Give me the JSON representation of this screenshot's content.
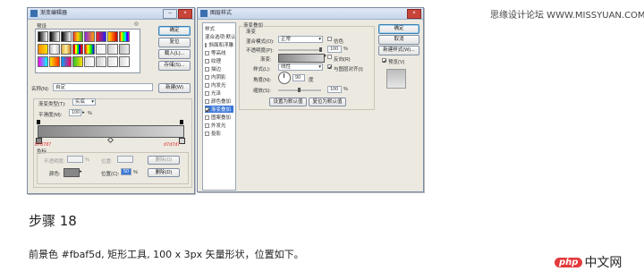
{
  "watermark": "思缘设计论坛 WWW.MISSYUAN.COM",
  "gradient_editor": {
    "title": "渐变编辑器",
    "presets_label": "预设",
    "ok": "确定",
    "reset": "复位",
    "load": "载入(L)...",
    "save": "存储(S)...",
    "name_label": "名称(N):",
    "name_value": "自定",
    "new": "新建(W)",
    "type_label": "渐变类型(T):",
    "type_value": "实底",
    "smooth_label": "平滑度(M):",
    "smooth_value": "100",
    "smooth_unit": "%",
    "stop_left_value": "878787",
    "stop_right_value": "d7d7d7",
    "stops_label": "色标",
    "opacity_label": "不透明度:",
    "opacity_unit": "%",
    "location_label": "位置:",
    "delete": "删除(D)",
    "color_label": "颜色:",
    "location2_label": "位置(C):",
    "location2_value": "50",
    "delete2": "删除(D)"
  },
  "layer_style": {
    "title": "图层样式",
    "styles_label": "样式",
    "blending_label": "混合选项:默认",
    "items": [
      {
        "label": "斜面和浮雕",
        "checked": false,
        "selected": false
      },
      {
        "label": "等高线",
        "checked": false,
        "selected": false
      },
      {
        "label": "纹理",
        "checked": false,
        "selected": false
      },
      {
        "label": "描边",
        "checked": false,
        "selected": false
      },
      {
        "label": "内阴影",
        "checked": false,
        "selected": false
      },
      {
        "label": "内发光",
        "checked": false,
        "selected": false
      },
      {
        "label": "光泽",
        "checked": false,
        "selected": false
      },
      {
        "label": "颜色叠加",
        "checked": false,
        "selected": false
      },
      {
        "label": "渐变叠加",
        "checked": true,
        "selected": true
      },
      {
        "label": "图案叠加",
        "checked": false,
        "selected": false
      },
      {
        "label": "外发光",
        "checked": false,
        "selected": false
      },
      {
        "label": "投影",
        "checked": false,
        "selected": false
      }
    ],
    "section_title": "渐变叠加",
    "sub_title": "渐变",
    "blend_mode_label": "混合模式(O):",
    "blend_mode_value": "正常",
    "dither_label": "仿色",
    "opacity_label": "不透明度(P):",
    "opacity_value": "100",
    "opacity_unit": "%",
    "gradient_label": "渐变:",
    "reverse_label": "反向(R)",
    "style_label": "样式(L):",
    "style_value": "线性",
    "align_label": "与图层对齐(I)",
    "angle_label": "角度(N):",
    "angle_value": "90",
    "angle_unit": "度",
    "scale_label": "缩放(S):",
    "scale_value": "100",
    "scale_unit": "%",
    "make_default": "设置为默认值",
    "reset_default": "复位为默认值",
    "ok": "确定",
    "cancel": "取消",
    "new_style": "新建样式(W)...",
    "preview_label": "预览(V)"
  },
  "step_caption": "步骤 18",
  "step_description": "前景色 #fbaf5d, 矩形工具, 100 x 3px 矢量形状，位置如下。",
  "logo": {
    "php": "php",
    "cn": "中文网"
  },
  "colors": {
    "selection": "#3875d7",
    "stop_text": "#e03030",
    "logo_red": "#e4393c"
  }
}
